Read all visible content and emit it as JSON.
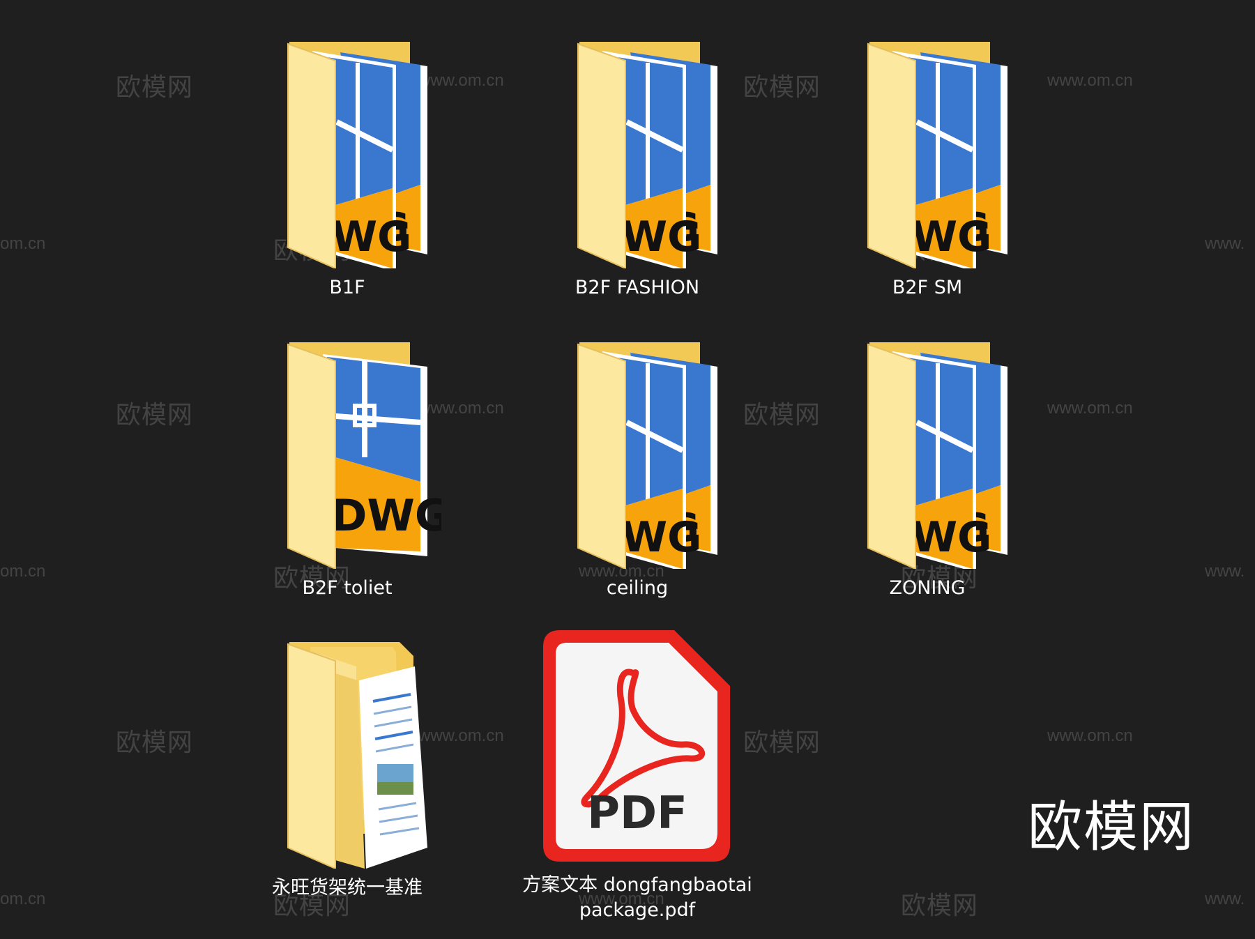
{
  "items": [
    {
      "label": "B1F",
      "icon": "dwg-folder-icon",
      "variant": "stacked"
    },
    {
      "label": "B2F FASHION",
      "icon": "dwg-folder-icon",
      "variant": "stacked"
    },
    {
      "label": "B2F SM",
      "icon": "dwg-folder-icon",
      "variant": "stacked"
    },
    {
      "label": "B2F toliet",
      "icon": "dwg-folder-icon",
      "variant": "single"
    },
    {
      "label": "ceiling",
      "icon": "dwg-folder-icon",
      "variant": "stacked"
    },
    {
      "label": "ZONING",
      "icon": "dwg-folder-icon",
      "variant": "stacked"
    },
    {
      "label": "永旺货架统一基准",
      "icon": "document-folder-icon"
    },
    {
      "label_line1": "方案文本 dongfangbaotai",
      "label_line2": "package.pdf",
      "icon": "pdf-file-icon",
      "pdf_text": "PDF"
    }
  ],
  "watermark": {
    "cn": "欧模网",
    "url": "www.om.cn",
    "url_cut_left": "om.cn",
    "url_cut_right": "www.",
    "brand": "欧模网"
  },
  "colors": {
    "background": "#1f1f1f",
    "folder": "#f7d36b",
    "folder_light": "#fde8a0",
    "dwg_blue": "#3a78d0",
    "dwg_orange": "#f6a30c",
    "pdf_red": "#e8261f"
  }
}
